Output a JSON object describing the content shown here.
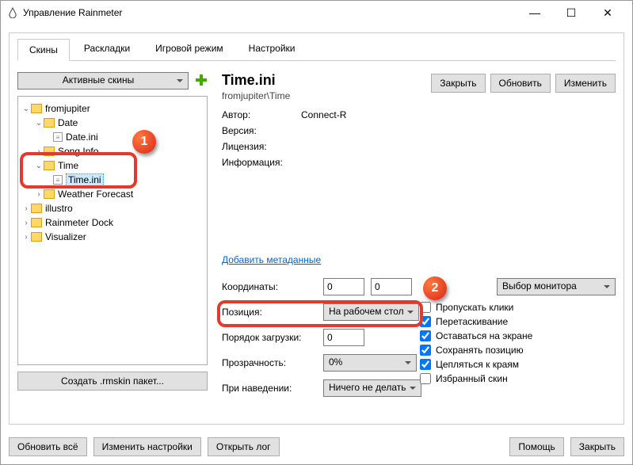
{
  "window": {
    "title": "Управление Rainmeter"
  },
  "tabs": {
    "skins": "Скины",
    "layouts": "Раскладки",
    "game": "Игровой режим",
    "settings": "Настройки"
  },
  "left": {
    "active_skins": "Активные скины",
    "create_pkg": "Создать .rmskin пакет...",
    "tree": {
      "fromjupiter": "fromjupiter",
      "date": "Date",
      "date_ini": "Date.ini",
      "song": "Song Info",
      "time": "Time",
      "time_ini": "Time.ini",
      "weather": "Weather Forecast",
      "illustro": "illustro",
      "dock": "Rainmeter Dock",
      "visualizer": "Visualizer"
    }
  },
  "right": {
    "title": "Time.ini",
    "path": "fromjupiter\\Time",
    "author_l": "Автор:",
    "author_v": "Connect-R",
    "version_l": "Версия:",
    "license_l": "Лицензия:",
    "info_l": "Информация:",
    "add_meta": "Добавить метаданные",
    "close": "Закрыть",
    "refresh": "Обновить",
    "edit": "Изменить",
    "coords_l": "Координаты:",
    "coord_x": "0",
    "coord_y": "0",
    "monitor": "Выбор монитора",
    "position_l": "Позиция:",
    "position_v": "На рабочем стол",
    "load_l": "Порядок загрузки:",
    "load_v": "0",
    "trans_l": "Прозрачность:",
    "trans_v": "0%",
    "hover_l": "При наведении:",
    "hover_v": "Ничего не делать",
    "chk_click": "Пропускать клики",
    "chk_drag": "Перетаскивание",
    "chk_screen": "Оставаться на экране",
    "chk_pos": "Сохранять позицию",
    "chk_snap": "Цепляться к краям",
    "chk_fav": "Избранный скин"
  },
  "footer": {
    "refresh_all": "Обновить всё",
    "edit_set": "Изменить настройки",
    "open_log": "Открыть лог",
    "help": "Помощь",
    "close": "Закрыть"
  }
}
